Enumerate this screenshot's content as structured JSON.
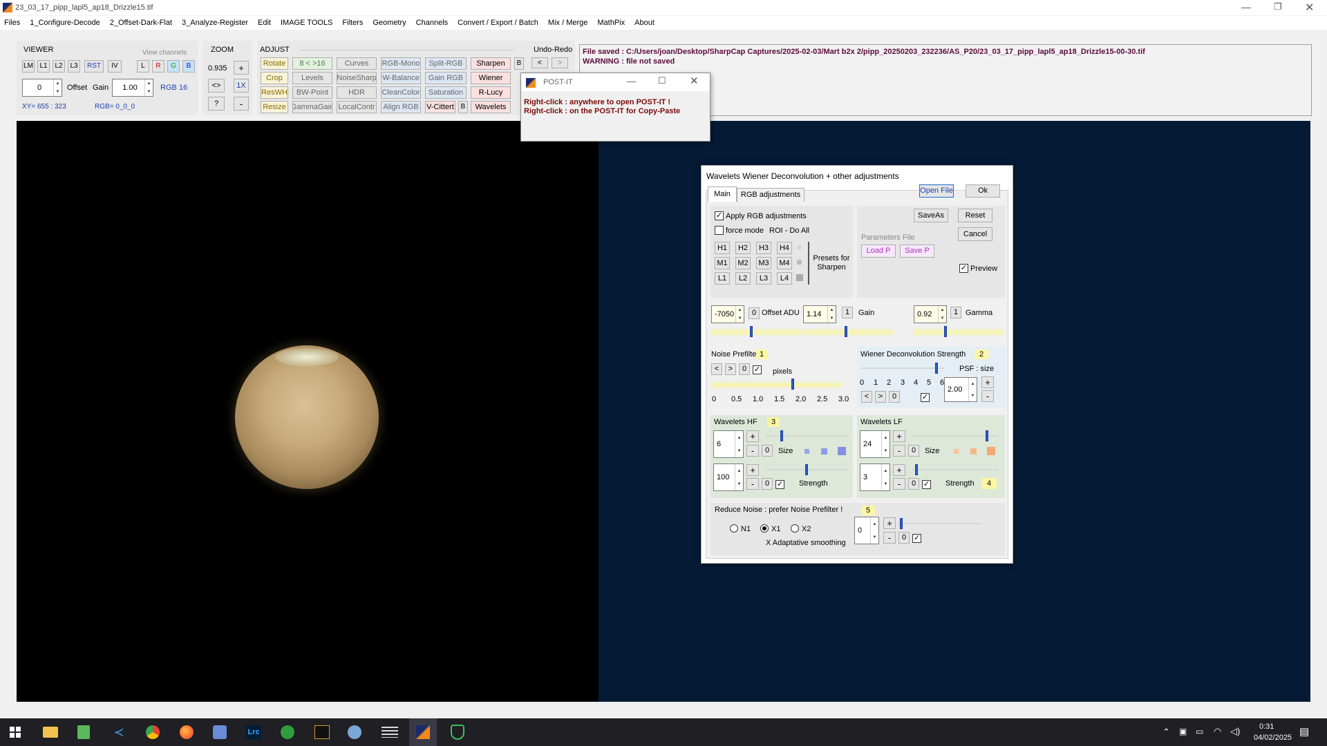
{
  "window": {
    "title": "23_03_17_pipp_lapl5_ap18_Drizzle15.tif"
  },
  "menu": [
    "Files",
    "1_Configure-Decode",
    "2_Offset-Dark-Flat",
    "3_Analyze-Register",
    "Edit",
    "IMAGE TOOLS",
    "Filters",
    "Geometry",
    "Channels",
    "Convert / Export / Batch",
    "Mix / Merge",
    "MathPix",
    "About"
  ],
  "viewer": {
    "title": "VIEWER",
    "view_channels": "View channels",
    "buttons": [
      "LM",
      "L1",
      "L2",
      "L3",
      "RST",
      "IV"
    ],
    "channels": [
      "L",
      "R",
      "G",
      "B"
    ],
    "offset_value": "0",
    "offset_label": "Offset",
    "gain_label": "Gain",
    "gain_value": "1.00",
    "rgb_label": "RGB 16",
    "xy": "XY= 655 : 323",
    "rgb": "RGB= 0_0_0"
  },
  "zoom": {
    "title": "ZOOM",
    "value": "0.935",
    "plus": "+",
    "fit": "<>",
    "onex": "1X",
    "help": "?",
    "minus": "-"
  },
  "adjust": {
    "title": "ADJUST",
    "row1": [
      "Rotate",
      "8 < >16",
      "Curves",
      "RGB-Mono",
      "Split-RGB",
      "Sharpen",
      "B"
    ],
    "row2": [
      "Crop",
      "Levels",
      "NoiseSharp",
      "W-Balance",
      "Gain RGB",
      "Wiener"
    ],
    "row3": [
      "ResWH",
      "BW-Point",
      "HDR",
      "CleanColor",
      "Saturation",
      "R-Lucy"
    ],
    "row4": [
      "Resize",
      "GammaGain",
      "LocalContr",
      "Align RGB",
      "V-Cittert",
      "B",
      "Wavelets"
    ]
  },
  "undo": {
    "title": "Undo-Redo",
    "undo": "<",
    "redo": ">"
  },
  "status": {
    "line1": "File saved :  C:/Users/joan/Desktop/SharpCap Captures/2025-02-03/Mart b2x 2/pipp_20250203_232236/AS_P20/23_03_17_pipp_lapl5_ap18_Drizzle15-00-30.tif",
    "line2": "WARNING : file not saved"
  },
  "postit": {
    "title": "POST-IT",
    "line1": "Right-click : anywhere to open POST-IT !",
    "line2": "Right-click : on the POST-IT for Copy-Paste"
  },
  "dialog": {
    "title": "Wavelets Wiener Deconvolution + other adjustments",
    "tabs": [
      "Main",
      "RGB adjustments"
    ],
    "open_file": "Open File",
    "ok": "Ok",
    "save_as": "SaveAs",
    "reset": "Reset",
    "cancel": "Cancel",
    "apply_rgb": "Apply RGB adjustments",
    "force_mode": "force mode",
    "roi": "ROI - Do All",
    "presets": {
      "h": [
        "H1",
        "H2",
        "H3",
        "H4"
      ],
      "m": [
        "M1",
        "M2",
        "M3",
        "M4"
      ],
      "l": [
        "L1",
        "L2",
        "L3",
        "L4"
      ],
      "label": "Presets for Sharpen"
    },
    "params_file": "Parameters File",
    "load_p": "Load P",
    "save_p": "Save P",
    "preview": "Preview",
    "offset_value": "-7050",
    "offset_zero": "0",
    "offset_label": "Offset ADU",
    "gain_value": "1.14",
    "gain_one": "1",
    "gain_label": "Gain",
    "gamma_value": "0.92",
    "gamma_one": "1",
    "gamma_label": "Gamma",
    "noise_prefilter": "Noise Prefilter",
    "noise_badge": "1",
    "noise_lt": "<",
    "noise_gt": ">",
    "noise_zero": "0",
    "pixels": "pixels",
    "noise_scale": [
      "0",
      "0.5",
      "1.0",
      "1.5",
      "2.0",
      "2.5",
      "3.0"
    ],
    "wiener_title": "Wiener Deconvolution Strength",
    "wiener_badge": "2",
    "psf_label": "PSF : size",
    "wiener_scale": [
      "0",
      "1",
      "2",
      "3",
      "4",
      "5",
      "6"
    ],
    "wiener_lt": "<",
    "wiener_gt": ">",
    "wiener_zero": "0",
    "psf_value": "2.00",
    "psf_plus": "+",
    "psf_minus": "-",
    "hf_title": "Wavelets HF",
    "hf_badge": "3",
    "hf_size_value": "6",
    "hf_strength_value": "100",
    "lf_title": "Wavelets LF",
    "lf_size_value": "24",
    "lf_strength_value": "3",
    "lf_badge": "4",
    "plus": "+",
    "minus": "-",
    "zero": "0",
    "size_label": "Size",
    "strength_label": "Strength",
    "reduce_noise": "Reduce Noise :  prefer Noise Prefilter !",
    "reduce_badge": "5",
    "n1": "N1",
    "x1": "X1",
    "x2": "X2",
    "adaptive": "X Adaptative smoothing",
    "reduce_value": "0"
  },
  "taskbar": {
    "time": "0:31",
    "date": "04/02/2025"
  },
  "colors": {
    "accent": "#2c5bd0",
    "status_text": "#5a0a3a",
    "canvas_right": "#051a35"
  }
}
